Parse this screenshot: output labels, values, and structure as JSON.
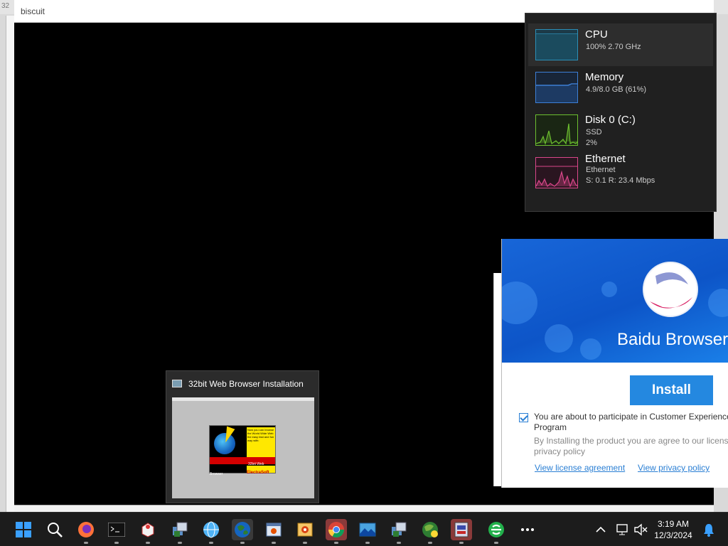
{
  "desktop": {
    "corner_text": "32"
  },
  "biscuit_window": {
    "title": "biscuit"
  },
  "performance": {
    "items": [
      {
        "name": "CPU",
        "line1": "100%  2.70 GHz",
        "line2": "",
        "color": "#2b8fb8"
      },
      {
        "name": "Memory",
        "line1": "4.9/8.0 GB (61%)",
        "line2": "",
        "color": "#3d7fd6"
      },
      {
        "name": "Disk 0 (C:)",
        "line1": "SSD",
        "line2": "2%",
        "color": "#6cbf2f"
      },
      {
        "name": "Ethernet",
        "line1": "Ethernet",
        "line2": "S: 0.1  R: 23.4 Mbps",
        "color": "#d9478a"
      }
    ]
  },
  "baidu_installer": {
    "brand": "Baidu Browser",
    "install_label": "Install",
    "consent_text": "You are about to participate in Customer Experience Program",
    "terms_text": "By Installing the product you are agree to our license privacy policy",
    "license_link": "View license agreement",
    "privacy_link": "View privacy policy",
    "consent_checked": true
  },
  "thumbnail": {
    "title": "32bit Web Browser Installation",
    "splash_text": "Now you can browse the World Wide Web the easy fast and fun way with:",
    "splash_product": "32bit Web Browser",
    "splash_company": "ElectraSoft"
  },
  "taskbar": {
    "icons": [
      "start-icon",
      "search-icon",
      "firefox-icon",
      "terminal-icon",
      "package-icon",
      "installer-icon",
      "globe-browser-icon",
      "32bit-browser-icon",
      "settings-window-icon",
      "image-viewer-icon",
      "chrome-icon",
      "photo-icon",
      "installer-2-icon",
      "globe-green-icon",
      "setup-icon",
      "baidu-icon",
      "more-icon"
    ],
    "clock_time": "3:19 AM",
    "clock_date": "12/3/2024"
  }
}
